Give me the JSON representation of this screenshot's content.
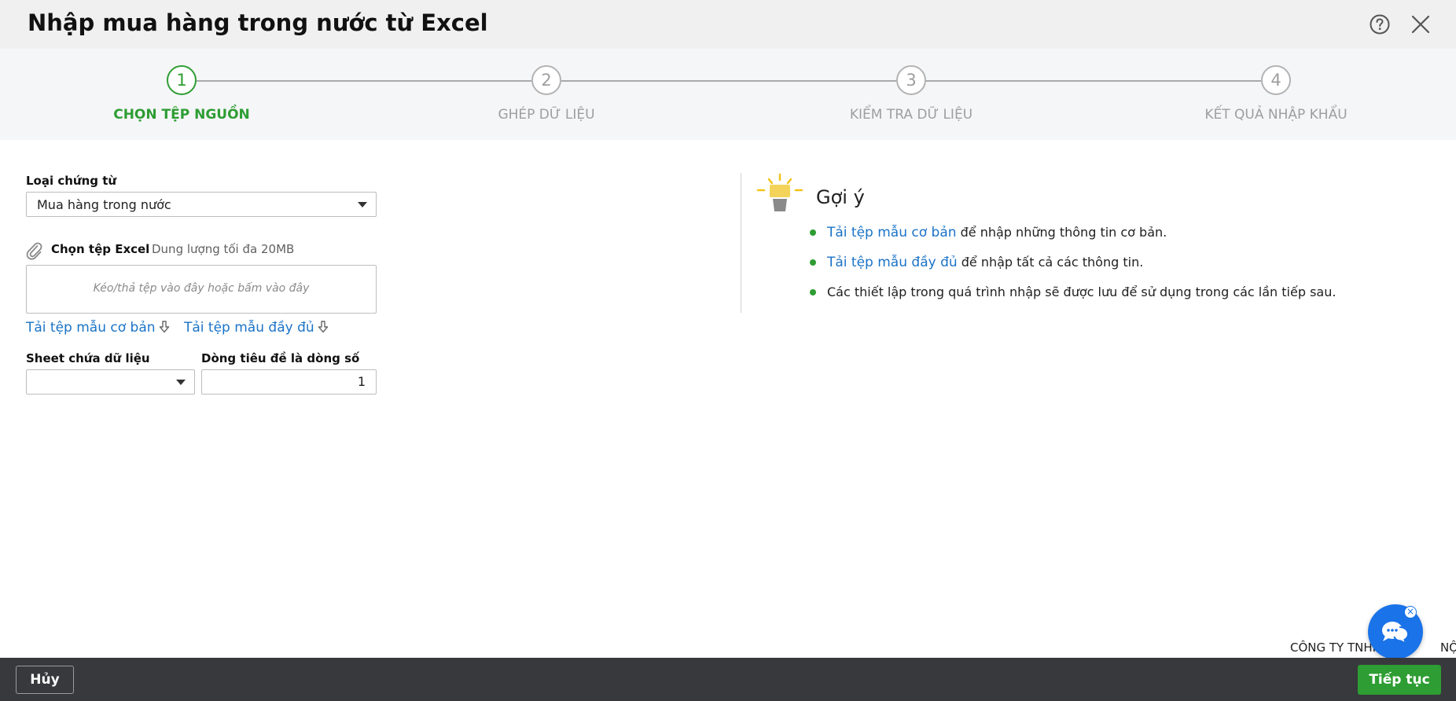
{
  "window": {
    "title": "Nhập mua hàng trong nước từ Excel"
  },
  "colors": {
    "accent": "#2e9d33",
    "link": "#1a73c7",
    "footer": "#38393d",
    "chat": "#1a73e8"
  },
  "steps": [
    {
      "number": "1",
      "label": "CHỌN TỆP NGUỒN",
      "active": true
    },
    {
      "number": "2",
      "label": "GHÉP DỮ LIỆU",
      "active": false
    },
    {
      "number": "3",
      "label": "KIỂM TRA DỮ LIỆU",
      "active": false
    },
    {
      "number": "4",
      "label": "KẾT QUẢ NHẬP KHẨU",
      "active": false
    }
  ],
  "form": {
    "doc_type_label": "Loại chứng từ",
    "doc_type_value": "Mua hàng trong nước",
    "file_label": "Chọn tệp Excel",
    "file_hint": "Dung lượng tối đa 20MB",
    "dropzone_text": "Kéo/thả tệp vào đây hoặc bấm vào đây",
    "download_basic": "Tải tệp mẫu cơ bản",
    "download_full": "Tải tệp mẫu đầy đủ",
    "sheet_label": "Sheet chứa dữ liệu",
    "sheet_value": "",
    "header_row_label": "Dòng tiêu đề là dòng số",
    "header_row_value": "1"
  },
  "tips": {
    "title": "Gợi ý",
    "items": [
      {
        "link": "Tải tệp mẫu cơ bản",
        "text": " để nhập những thông tin cơ bản."
      },
      {
        "link": "Tải tệp mẫu đầy đủ",
        "text": " để nhập tất cả các thông tin."
      },
      {
        "link": "",
        "text": "Các thiết lập trong quá trình nhập sẽ được lưu để sử dụng trong các lần tiếp sau."
      }
    ]
  },
  "company_text": "CÔNG TY TNHH",
  "company_text_end": "NỘI",
  "footer": {
    "cancel_label": "Hủy",
    "next_label": "Tiếp tục"
  },
  "icons": [
    "help-icon",
    "close-icon",
    "paperclip-icon",
    "download-icon",
    "lightbulb-icon",
    "chat-icon"
  ]
}
